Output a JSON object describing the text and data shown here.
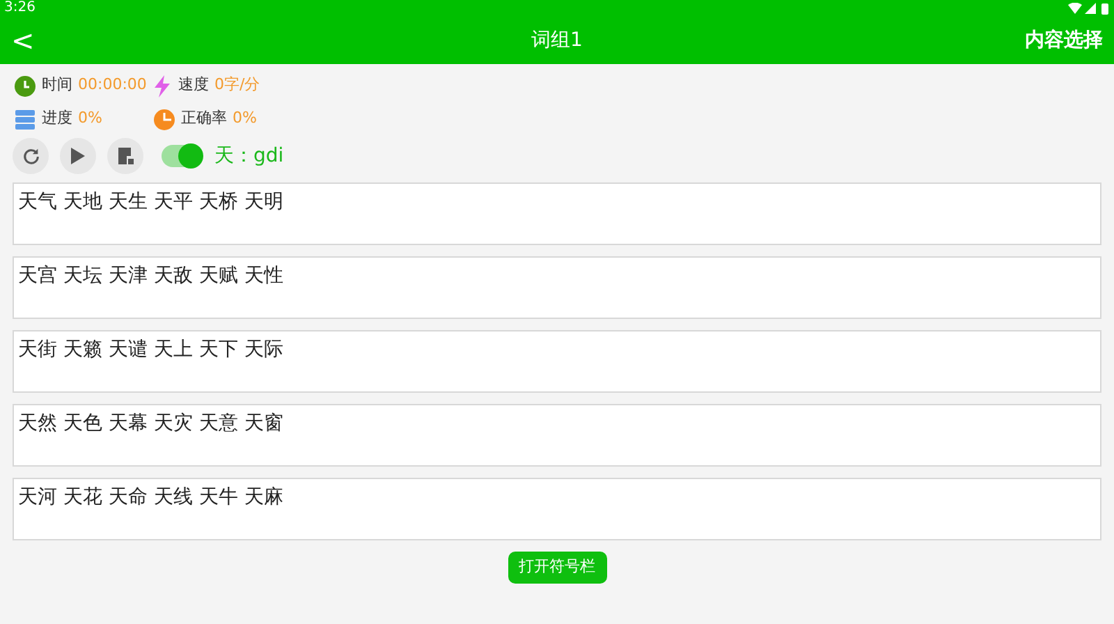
{
  "status_bar": {
    "time": "3:26"
  },
  "toolbar": {
    "back": "<",
    "title": "词组1",
    "action": "内容选择"
  },
  "stats": [
    {
      "kind": "time",
      "label": "时间",
      "value": "00:00:00"
    },
    {
      "kind": "speed",
      "label": "速度",
      "value": "0字/分"
    },
    {
      "kind": "progress",
      "label": "进度",
      "value": "0%"
    },
    {
      "kind": "accuracy",
      "label": "正确率",
      "value": "0%"
    }
  ],
  "toggle": {
    "on": true
  },
  "current": "天：gdi",
  "groups": [
    "天气 天地 天生 天平 天桥 天明",
    "天宫 天坛 天津 天敌 天赋 天性",
    "天街 天籁 天谴 天上 天下 天际",
    "天然 天色 天幕 天灾 天意 天窗",
    "天河 天花 天命 天线 天牛 天麻"
  ],
  "symbol_button": "打开符号栏"
}
